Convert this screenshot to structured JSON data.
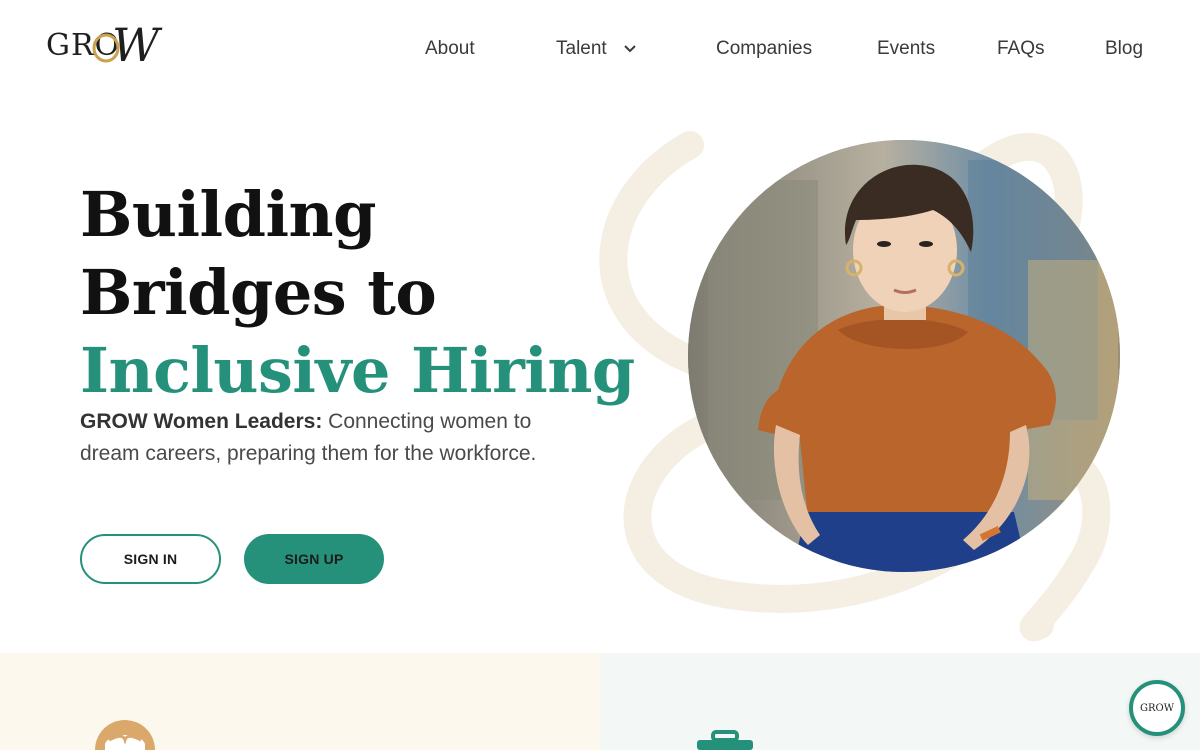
{
  "brand": {
    "logo_text": "GRO",
    "logo_w": "W",
    "accent_color": "#25917b",
    "gold_color": "#c9a24c"
  },
  "nav": {
    "about": "About",
    "talent": "Talent",
    "companies": "Companies",
    "events": "Events",
    "faqs": "FAQs",
    "blog": "Blog"
  },
  "hero": {
    "title_line1": "Building",
    "title_line2": "Bridges to",
    "title_line3": "Inclusive Hiring",
    "desc_bold": "GROW Women Leaders:",
    "desc_rest": " Connecting women to dream careers, preparing them for the workforce.",
    "signin_label": "SIGN IN",
    "signup_label": "SIGN UP"
  },
  "chat_widget": {
    "logo_text": "GROW"
  }
}
